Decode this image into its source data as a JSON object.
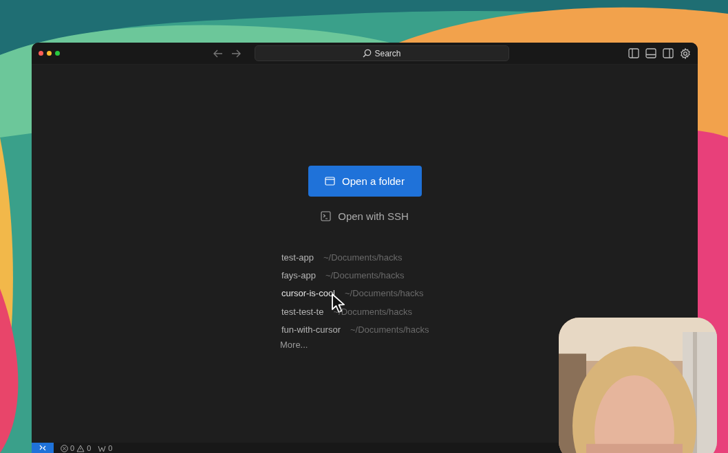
{
  "titlebar": {
    "search": {
      "label": "Search"
    }
  },
  "actions": [
    {
      "kind": "primary",
      "label": "Open a folder"
    },
    {
      "kind": "secondary",
      "label": "Open with SSH"
    }
  ],
  "recent": [
    {
      "name": "test-app",
      "path": "~/Documents/hacks",
      "hovered": false
    },
    {
      "name": "fays-app",
      "path": "~/Documents/hacks",
      "hovered": false
    },
    {
      "name": "cursor-is-cool",
      "path": "~/Documents/hacks",
      "hovered": true
    },
    {
      "name": "test-test-te",
      "path": "~/Documents/hacks",
      "hovered": false
    },
    {
      "name": "fun-with-cursor",
      "path": "~/Documents/hacks",
      "hovered": false
    }
  ],
  "more": "More...",
  "status_bar": {
    "errors": "0",
    "warnings": "0",
    "ports": "0"
  }
}
